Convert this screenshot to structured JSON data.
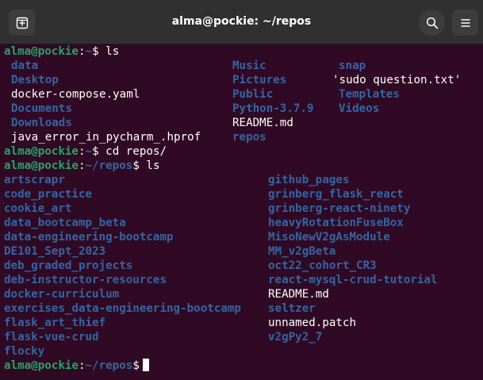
{
  "window": {
    "title": "alma@pockie: ~/repos"
  },
  "prompts": [
    {
      "user": "alma@pockie",
      "sep": ":",
      "path": "~",
      "sym": "$",
      "cmd": " ls"
    },
    {
      "user": "alma@pockie",
      "sep": ":",
      "path": "~",
      "sym": "$",
      "cmd": " cd repos/"
    },
    {
      "user": "alma@pockie",
      "sep": ":",
      "path": "~/repos",
      "sym": "$",
      "cmd": " ls"
    },
    {
      "user": "alma@pockie",
      "sep": ":",
      "path": "~/repos",
      "sym": "$",
      "cmd": ""
    }
  ],
  "home_listing": [
    {
      "name": "data",
      "kind": "dir"
    },
    {
      "name": "Music",
      "kind": "dir"
    },
    {
      "name": "snap",
      "kind": "dir"
    },
    {
      "name": "Desktop",
      "kind": "dir"
    },
    {
      "name": "Pictures",
      "kind": "dir"
    },
    {
      "name": "'sudo question.txt'",
      "kind": "file"
    },
    {
      "name": "docker-compose.yaml",
      "kind": "file"
    },
    {
      "name": "Public",
      "kind": "dir"
    },
    {
      "name": "Templates",
      "kind": "dir"
    },
    {
      "name": "Documents",
      "kind": "dir"
    },
    {
      "name": "Python-3.7.9",
      "kind": "dir"
    },
    {
      "name": "Videos",
      "kind": "dir"
    },
    {
      "name": "Downloads",
      "kind": "dir"
    },
    {
      "name": "README.md",
      "kind": "file"
    },
    {
      "name": "java_error_in_pycharm_.hprof",
      "kind": "file"
    },
    {
      "name": "repos",
      "kind": "dir"
    }
  ],
  "repos_listing": [
    {
      "name": "artscrapr",
      "kind": "dir"
    },
    {
      "name": "github_pages",
      "kind": "dir"
    },
    {
      "name": "code_practice",
      "kind": "dir"
    },
    {
      "name": "grinberg_flask_react",
      "kind": "dir"
    },
    {
      "name": "cookie_art",
      "kind": "dir"
    },
    {
      "name": "grinberg-react-ninety",
      "kind": "dir"
    },
    {
      "name": "data_bootcamp_beta",
      "kind": "dir"
    },
    {
      "name": "heavyRotationFuseBox",
      "kind": "dir"
    },
    {
      "name": "data-engineering-bootcamp",
      "kind": "dir"
    },
    {
      "name": "MisoNewV2gAsModule",
      "kind": "dir"
    },
    {
      "name": "DE101_Sept_2023",
      "kind": "dir"
    },
    {
      "name": "MM_v2gBeta",
      "kind": "dir"
    },
    {
      "name": "deb_graded_projects",
      "kind": "dir"
    },
    {
      "name": "oct22_cohort_CR3",
      "kind": "dir"
    },
    {
      "name": "deb-instructor-resources",
      "kind": "dir"
    },
    {
      "name": "react-mysql-crud-tutorial",
      "kind": "dir"
    },
    {
      "name": "docker-curriculum",
      "kind": "dir"
    },
    {
      "name": "README.md",
      "kind": "file"
    },
    {
      "name": "exercises_data-engineering-bootcamp",
      "kind": "dir"
    },
    {
      "name": "seltzer",
      "kind": "dir"
    },
    {
      "name": "flask_art_thief",
      "kind": "dir"
    },
    {
      "name": "unnamed.patch",
      "kind": "file"
    },
    {
      "name": "flask-vue-crud",
      "kind": "dir"
    },
    {
      "name": "v2gPy2_7",
      "kind": "dir"
    },
    {
      "name": "flocky",
      "kind": "dir"
    }
  ],
  "colors": {
    "background": "#300a24",
    "titlebar": "#303030",
    "user": "#26a269",
    "path": "#3465a4",
    "directory": "#3465a4",
    "text": "#ffffff"
  },
  "icons": {
    "new_tab": "new-tab-icon",
    "search": "search-icon",
    "menu": "hamburger-menu-icon"
  }
}
